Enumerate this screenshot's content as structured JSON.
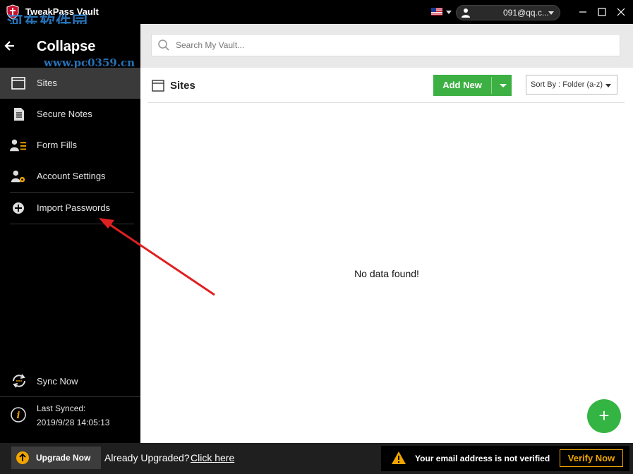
{
  "window": {
    "title": "TweakPass Vault",
    "account_email": "091@qq.c...",
    "flag": "us-flag",
    "watermark_cn": "河东软件园",
    "watermark_url": "www.pc0359.cn"
  },
  "sidebar": {
    "collapse_label": "Collapse",
    "items": [
      {
        "label": "Sites",
        "icon": "browser-window-icon",
        "active": true
      },
      {
        "label": "Secure Notes",
        "icon": "note-icon"
      },
      {
        "label": "Form Fills",
        "icon": "user-form-icon"
      },
      {
        "label": "Account Settings",
        "icon": "user-gear-icon"
      },
      {
        "label": "Import Passwords",
        "icon": "plus-circle-icon"
      }
    ],
    "sync_label": "Sync Now",
    "last_synced_label": "Last Synced:",
    "last_synced_value": "2019/9/28 14:05:13"
  },
  "search": {
    "placeholder": "Search My Vault..."
  },
  "main": {
    "section_title": "Sites",
    "add_new_label": "Add New",
    "sort_label": "Sort By :  Folder (a-z)",
    "empty_message": "No data found!"
  },
  "footer": {
    "upgrade_label": "Upgrade Now",
    "already_upgraded": "Already Upgraded?",
    "click_here": "Click here",
    "notice_text": "Your email address is not verified",
    "verify_label": "Verify Now"
  },
  "colors": {
    "accent_green": "#3cb043",
    "warning_orange": "#f0a500",
    "arrow_red": "#e02020"
  }
}
